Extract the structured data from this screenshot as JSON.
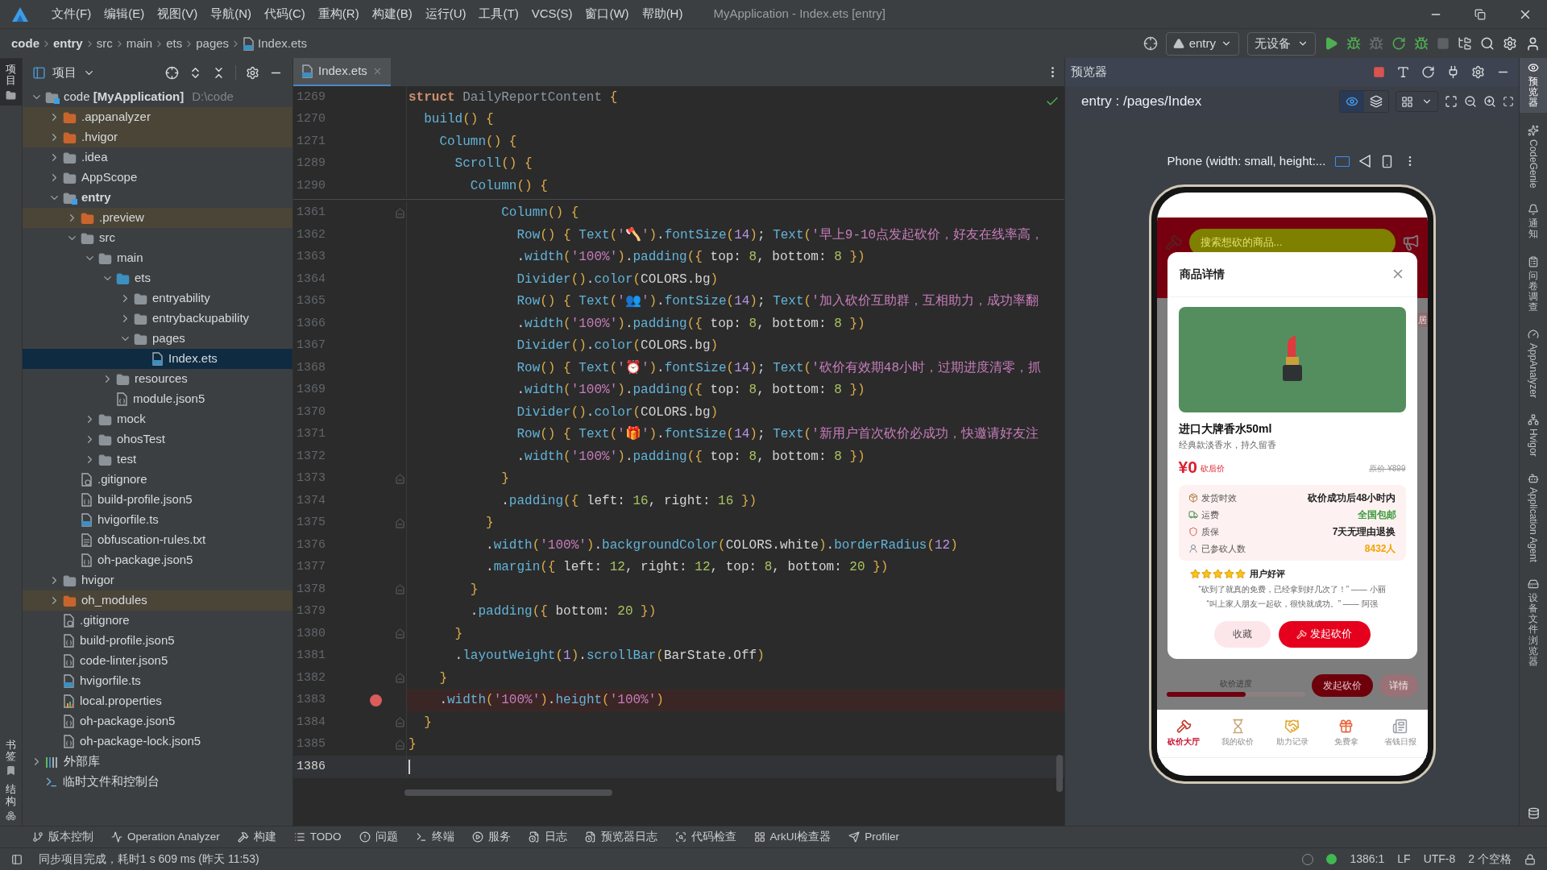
{
  "title_bar": {
    "menus": [
      "文件(F)",
      "编辑(E)",
      "视图(V)",
      "导航(N)",
      "代码(C)",
      "重构(R)",
      "构建(B)",
      "运行(U)",
      "工具(T)",
      "VCS(S)",
      "窗口(W)",
      "帮助(H)"
    ],
    "title": "MyApplication - Index.ets [entry]"
  },
  "breadcrumb": [
    {
      "label": "code",
      "kind": "module"
    },
    {
      "label": "entry",
      "kind": "module"
    },
    {
      "label": "src",
      "kind": "dir"
    },
    {
      "label": "main",
      "kind": "dir"
    },
    {
      "label": "ets",
      "kind": "dir"
    },
    {
      "label": "pages",
      "kind": "dir"
    },
    {
      "label": "Index.ets",
      "kind": "file"
    }
  ],
  "run_toolbar": {
    "module": "entry",
    "device": "无设备"
  },
  "left_strip": {
    "top": [
      {
        "label": "项目",
        "selected": true
      }
    ],
    "bottom": [
      {
        "label": "书签",
        "selected": false
      },
      {
        "label": "结构",
        "selected": false
      }
    ]
  },
  "project_panel": {
    "title": "项目",
    "tree": [
      {
        "label": "code **[MyApplication]**",
        "kind": "project",
        "hint": "D:\\code",
        "expanded": true,
        "selected": false,
        "children": [
          {
            "label": ".appanalyzer",
            "kind": "excluded",
            "expanded": false,
            "selected": false
          },
          {
            "label": ".hvigor",
            "kind": "excluded",
            "expanded": false,
            "selected": false
          },
          {
            "label": ".idea",
            "kind": "folder",
            "expanded": false,
            "selected": false
          },
          {
            "label": "AppScope",
            "kind": "folder",
            "expanded": false,
            "selected": false
          },
          {
            "label": "entry",
            "kind": "module",
            "expanded": true,
            "selected": false,
            "children": [
              {
                "label": ".preview",
                "kind": "excluded",
                "expanded": false,
                "selected": false
              },
              {
                "label": "src",
                "kind": "folder",
                "expanded": true,
                "selected": false,
                "children": [
                  {
                    "label": "main",
                    "kind": "folder",
                    "expanded": true,
                    "selected": false,
                    "children": [
                      {
                        "label": "ets",
                        "kind": "source",
                        "expanded": true,
                        "selected": false,
                        "children": [
                          {
                            "label": "entryability",
                            "kind": "folder",
                            "expanded": false,
                            "selected": false
                          },
                          {
                            "label": "entrybackupability",
                            "kind": "folder",
                            "expanded": false,
                            "selected": false
                          },
                          {
                            "label": "pages",
                            "kind": "folder",
                            "expanded": true,
                            "selected": false,
                            "children": [
                              {
                                "label": "Index.ets",
                                "kind": "ets",
                                "selected": true
                              }
                            ]
                          }
                        ]
                      },
                      {
                        "label": "resources",
                        "kind": "folder",
                        "expanded": false,
                        "selected": false
                      },
                      {
                        "label": "module.json5",
                        "kind": "json",
                        "selected": false
                      }
                    ]
                  },
                  {
                    "label": "mock",
                    "kind": "folder",
                    "expanded": false,
                    "selected": false
                  },
                  {
                    "label": "ohosTest",
                    "kind": "folder",
                    "expanded": false,
                    "selected": false
                  },
                  {
                    "label": "test",
                    "kind": "folder",
                    "expanded": false,
                    "selected": false
                  }
                ]
              },
              {
                "label": ".gitignore",
                "kind": "ignore",
                "selected": false
              },
              {
                "label": "build-profile.json5",
                "kind": "json",
                "selected": false
              },
              {
                "label": "hvigorfile.ts",
                "kind": "ts",
                "selected": false
              },
              {
                "label": "obfuscation-rules.txt",
                "kind": "txt",
                "selected": false
              },
              {
                "label": "oh-package.json5",
                "kind": "json",
                "selected": false
              }
            ]
          },
          {
            "label": "hvigor",
            "kind": "folder",
            "expanded": false,
            "selected": false
          },
          {
            "label": "oh_modules",
            "kind": "excluded",
            "expanded": false,
            "selected": false
          },
          {
            "label": ".gitignore",
            "kind": "ignore",
            "selected": false
          },
          {
            "label": "build-profile.json5",
            "kind": "json",
            "selected": false
          },
          {
            "label": "code-linter.json5",
            "kind": "json",
            "selected": false
          },
          {
            "label": "hvigorfile.ts",
            "kind": "ts",
            "selected": false
          },
          {
            "label": "local.properties",
            "kind": "props",
            "selected": false
          },
          {
            "label": "oh-package.json5",
            "kind": "json",
            "selected": false
          },
          {
            "label": "oh-package-lock.json5",
            "kind": "json",
            "selected": false
          }
        ]
      },
      {
        "label": "外部库",
        "kind": "library",
        "expanded": false,
        "selected": false
      },
      {
        "label": "临时文件和控制台",
        "kind": "scratch",
        "selected": false
      }
    ]
  },
  "editor": {
    "tab": {
      "label": "Index.ets",
      "selected": true
    },
    "sticky_lines": [
      {
        "number": "1269",
        "text": "struct DailyReportContent {"
      },
      {
        "number": "1270",
        "text": "  build() {"
      },
      {
        "number": "1271",
        "text": "    Column() {"
      },
      {
        "number": "1289",
        "text": "      Scroll() {"
      },
      {
        "number": "1290",
        "text": "        Column() {"
      }
    ],
    "lines": [
      {
        "number": "1361",
        "fold": true,
        "breakpoint": false,
        "caret": false,
        "text": "            Column() {"
      },
      {
        "number": "1362",
        "fold": false,
        "breakpoint": false,
        "caret": false,
        "text": "              Row() { Text('🪓').fontSize(14); Text('早上9-10点发起砍价，好友在线率高，"
      },
      {
        "number": "1363",
        "fold": false,
        "breakpoint": false,
        "caret": false,
        "text": "              .width('100%').padding({ top: 8, bottom: 8 })"
      },
      {
        "number": "1364",
        "fold": false,
        "breakpoint": false,
        "caret": false,
        "text": "              Divider().color(COLORS.bg)"
      },
      {
        "number": "1365",
        "fold": false,
        "breakpoint": false,
        "caret": false,
        "text": "              Row() { Text('👥').fontSize(14); Text('加入砍价互助群，互相助力，成功率翻"
      },
      {
        "number": "1366",
        "fold": false,
        "breakpoint": false,
        "caret": false,
        "text": "              .width('100%').padding({ top: 8, bottom: 8 })"
      },
      {
        "number": "1367",
        "fold": false,
        "breakpoint": false,
        "caret": false,
        "text": "              Divider().color(COLORS.bg)"
      },
      {
        "number": "1368",
        "fold": false,
        "breakpoint": false,
        "caret": false,
        "text": "              Row() { Text('⏰').fontSize(14); Text('砍价有效期48小时，过期进度清零，抓"
      },
      {
        "number": "1369",
        "fold": false,
        "breakpoint": false,
        "caret": false,
        "text": "              .width('100%').padding({ top: 8, bottom: 8 })"
      },
      {
        "number": "1370",
        "fold": false,
        "breakpoint": false,
        "caret": false,
        "text": "              Divider().color(COLORS.bg)"
      },
      {
        "number": "1371",
        "fold": false,
        "breakpoint": false,
        "caret": false,
        "text": "              Row() { Text('🎁').fontSize(14); Text('新用户首次砍价必成功，快邀请好友注"
      },
      {
        "number": "1372",
        "fold": false,
        "breakpoint": false,
        "caret": false,
        "text": "              .width('100%').padding({ top: 8, bottom: 8 })"
      },
      {
        "number": "1373",
        "fold": true,
        "breakpoint": false,
        "caret": false,
        "text": "            }"
      },
      {
        "number": "1374",
        "fold": false,
        "breakpoint": false,
        "caret": false,
        "text": "            .padding({ left: 16, right: 16 })"
      },
      {
        "number": "1375",
        "fold": true,
        "breakpoint": false,
        "caret": false,
        "text": "          }"
      },
      {
        "number": "1376",
        "fold": false,
        "breakpoint": false,
        "caret": false,
        "text": "          .width('100%').backgroundColor(COLORS.white).borderRadius(12)"
      },
      {
        "number": "1377",
        "fold": false,
        "breakpoint": false,
        "caret": false,
        "text": "          .margin({ left: 12, right: 12, top: 8, bottom: 20 })"
      },
      {
        "number": "1378",
        "fold": true,
        "breakpoint": false,
        "caret": false,
        "text": "        }"
      },
      {
        "number": "1379",
        "fold": false,
        "breakpoint": false,
        "caret": false,
        "text": "        .padding({ bottom: 20 })"
      },
      {
        "number": "1380",
        "fold": true,
        "breakpoint": false,
        "caret": false,
        "text": "      }"
      },
      {
        "number": "1381",
        "fold": false,
        "breakpoint": false,
        "caret": false,
        "text": "      .layoutWeight(1).scrollBar(BarState.Off)"
      },
      {
        "number": "1382",
        "fold": true,
        "breakpoint": false,
        "caret": false,
        "text": "    }"
      },
      {
        "number": "1383",
        "fold": false,
        "breakpoint": true,
        "caret": false,
        "text": "    .width('100%').height('100%')"
      },
      {
        "number": "1384",
        "fold": true,
        "breakpoint": false,
        "caret": false,
        "text": "  }"
      },
      {
        "number": "1385",
        "fold": true,
        "breakpoint": false,
        "caret": false,
        "text": "}"
      },
      {
        "number": "1386",
        "fold": false,
        "breakpoint": false,
        "caret": true
      }
    ]
  },
  "preview": {
    "title": "预览器",
    "page": "entry : /pages/Index",
    "device": "Phone (width: small, height:...",
    "phone": {
      "search_placeholder": "搜索想砍的商品...",
      "behind_tag": "居",
      "progress": {
        "label": "砍价进度",
        "level": 0.57,
        "buttons": [
          "发起砍价",
          "详情"
        ]
      },
      "dialog": {
        "title": "商品详情",
        "name": "进口大牌香水50ml",
        "description": "经典款淡香水，持久留香",
        "price": "¥0",
        "price_note": "砍后价",
        "original_price": "原价 ¥899",
        "info": [
          {
            "kind": "box",
            "label": "发货时效",
            "value": "砍价成功后48小时内",
            "color": "#222222"
          },
          {
            "kind": "truck",
            "label": "运费",
            "value": "全国包邮",
            "color": "#3c9a3c"
          },
          {
            "kind": "shield",
            "label": "质保",
            "value": "7天无理由退换",
            "color": "#222222"
          },
          {
            "kind": "person",
            "label": "已参砍人数",
            "value": "8432人",
            "color": "#f5a300"
          }
        ],
        "review": {
          "stars": 5,
          "title": "用户好评",
          "quotes": [
            "“砍到了就真的免费，已经拿到好几次了！” —— 小丽",
            "“叫上家人朋友一起砍，很快就成功。” —— 阿强"
          ]
        },
        "buttons": [
          {
            "label": "收藏",
            "kind": "secondary"
          },
          {
            "label": "发起砍价",
            "kind": "primary"
          }
        ]
      },
      "nav": [
        {
          "label": "砍价大厅",
          "kind": "axe",
          "selected": true
        },
        {
          "label": "我的砍价",
          "kind": "hourglass",
          "selected": false
        },
        {
          "label": "助力记录",
          "kind": "handshake",
          "selected": false
        },
        {
          "label": "免费拿",
          "kind": "gift",
          "selected": false
        },
        {
          "label": "省钱日报",
          "kind": "newspaper",
          "selected": false
        }
      ]
    }
  },
  "right_strip": [
    {
      "label": "预览器",
      "kind": "cjk",
      "selected": true
    },
    {
      "label": "CodeGenie",
      "kind": "latin",
      "selected": false
    },
    {
      "label": "通知",
      "kind": "cjk",
      "selected": false
    },
    {
      "label": "问卷调查",
      "kind": "cjk",
      "selected": false
    },
    {
      "label": "AppAnalyzer",
      "kind": "latin",
      "selected": false
    },
    {
      "label": "Hvigor",
      "kind": "latin",
      "selected": false
    },
    {
      "label": "Application Agent",
      "kind": "latin",
      "selected": false
    },
    {
      "label": "设备文件浏览器",
      "kind": "cjk",
      "selected": false
    }
  ],
  "tool_windows": [
    {
      "label": "版本控制",
      "kind": "vcs"
    },
    {
      "label": "Operation Analyzer",
      "kind": "analyzer"
    },
    {
      "label": "构建",
      "kind": "build"
    },
    {
      "label": "TODO",
      "kind": "todo"
    },
    {
      "label": "问题",
      "kind": "problems"
    },
    {
      "label": "终端",
      "kind": "terminal"
    },
    {
      "label": "服务",
      "kind": "services"
    },
    {
      "label": "日志",
      "kind": "log"
    },
    {
      "label": "预览器日志",
      "kind": "preview_log"
    },
    {
      "label": "代码检查",
      "kind": "inspect"
    },
    {
      "label": "ArkUI检查器",
      "kind": "arkui"
    },
    {
      "label": "Profiler",
      "kind": "profiler"
    }
  ],
  "status_bar": {
    "message": "同步项目完成，耗时1 s 609 ms (昨天 11:53)",
    "position": "1386:1",
    "line_ending": "LF",
    "encoding": "UTF-8",
    "indent": "2 个空格"
  }
}
